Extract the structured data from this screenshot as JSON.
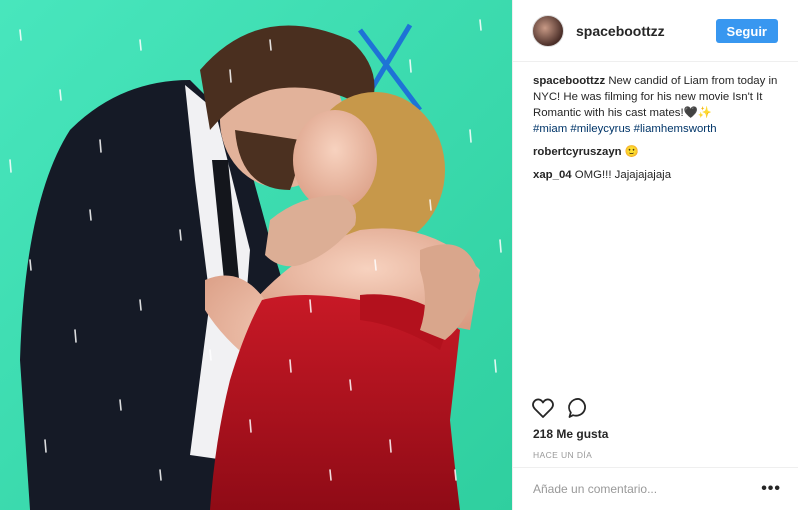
{
  "post": {
    "username": "spaceboottzz",
    "follow_label": "Seguir",
    "likes_text": "218 Me gusta",
    "time_text": "HACE UN DÍA",
    "add_comment_placeholder": "Añade un comentario...",
    "more_label": "•••",
    "icons": [
      "heart-icon",
      "comment-icon",
      "more-options-icon"
    ],
    "accent_color": "#3897f0",
    "media_background": "#3fe0b4"
  },
  "comments": {
    "caption": {
      "user": "spaceboottzz",
      "text": " New candid of Liam from today in NYC! He was filming for his new movie Isn't It Romantic with his cast mates!🖤✨",
      "tags": [
        "#miam",
        "#mileycyrus",
        "#liamhemsworth"
      ]
    },
    "c1": {
      "user": "robertcyruszayn",
      "text": " 🙂"
    },
    "c2": {
      "user": "xap_04",
      "text": " OMG!!! Jajajajajaja"
    }
  }
}
